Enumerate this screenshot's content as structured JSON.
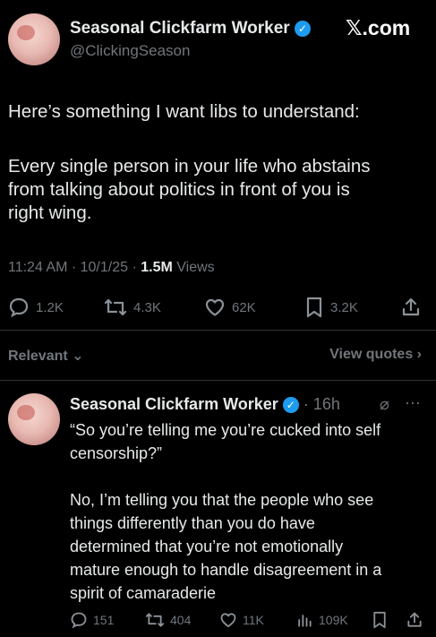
{
  "brand": {
    "site": "𝕏.com"
  },
  "tweet": {
    "author_name": "Seasonal Clickfarm Worker",
    "author_handle": "@ClickingSeason",
    "line1": "Here’s something I want libs to understand:",
    "line2": "Every single person in your life who abstains",
    "line3": "from talking about politics in front of you is",
    "line4": "right wing.",
    "time": "11:24 AM · 10/1/25 · ",
    "views_count": "1.5M",
    "views_label": " Views",
    "replies": "1.2K",
    "reposts": "4.3K",
    "likes": "62K",
    "bookmarks": "3.2K"
  },
  "filter": {
    "relevant": "Relevant",
    "view_quotes": "View quotes"
  },
  "reply": {
    "author_name": "Seasonal Clickfarm Worker",
    "age": "· 16h",
    "quote_l1": "“So you’re telling me you’re cucked into self",
    "quote_l2": "censorship?”",
    "body_l1": "No, I’m telling you that the people who see",
    "body_l2": "things differently than you do have",
    "body_l3": "determined that you’re not emotionally",
    "body_l4": "mature enough to handle disagreement in a",
    "body_l5": "spirit of camaraderie",
    "replies": "151",
    "reposts": "404",
    "likes": "11K",
    "views": "109K"
  },
  "colors": {
    "background": "#000000",
    "text": "#e7e9ea",
    "muted": "#71767b",
    "verified": "#1d9bf0"
  }
}
